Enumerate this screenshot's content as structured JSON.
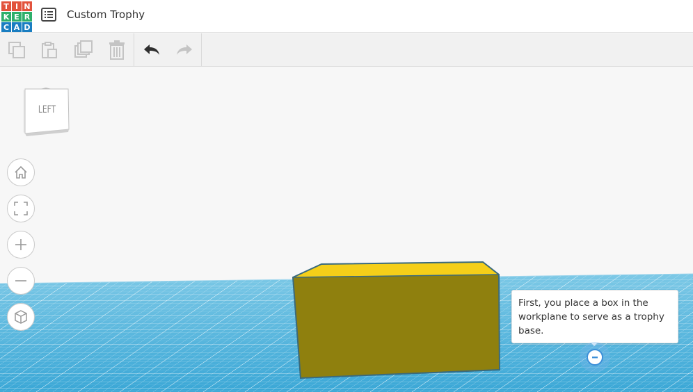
{
  "app": {
    "logo_letters": [
      "T",
      "I",
      "N",
      "K",
      "E",
      "R",
      "C",
      "A",
      "D"
    ],
    "logo_colors": [
      "#e2533d",
      "#e2533d",
      "#e2533d",
      "#2eaf6b",
      "#2eaf6b",
      "#2eaf6b",
      "#1a7ec1",
      "#1a7ec1",
      "#1a7ec1"
    ],
    "design_title": "Custom Trophy"
  },
  "toolbar": {
    "tools": [
      "copy-icon",
      "paste-icon",
      "duplicate-icon",
      "delete-icon",
      "undo-icon",
      "redo-icon"
    ]
  },
  "viewcube": {
    "face_label": "LEFT"
  },
  "nav": {
    "buttons": [
      "home-icon",
      "fit-view-icon",
      "zoom-in-icon",
      "zoom-out-icon",
      "perspective-icon"
    ]
  },
  "scene": {
    "shape": "box",
    "top_color": "#f5cf19",
    "front_color": "#8f800e",
    "edge_color": "#3a6a7d",
    "workplane_color": "#4ab3dc"
  },
  "tutorial": {
    "tooltip_text": "First, you place a box in the workplane to serve as a trophy base."
  }
}
